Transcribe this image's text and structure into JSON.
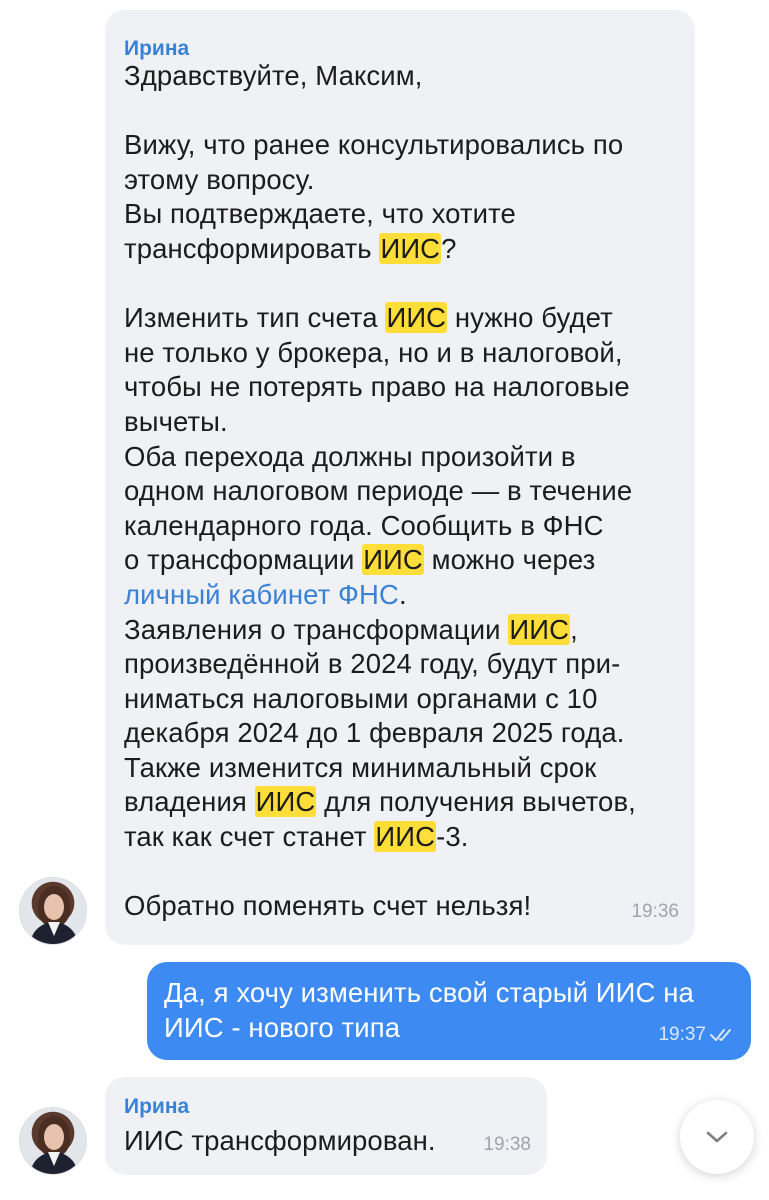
{
  "chat": {
    "messages": [
      {
        "sender": "Ирина",
        "time": "19:36",
        "lines": [
          [
            {
              "t": "Здравствуйте, Максим,"
            }
          ],
          [],
          [
            {
              "t": "Вижу, что ранее консультировались по"
            }
          ],
          [
            {
              "t": "этому вопросу."
            }
          ],
          [
            {
              "t": "Вы подтверждаете, что хотите"
            }
          ],
          [
            {
              "t": "трансформировать "
            },
            {
              "t": "ИИС",
              "hl": true
            },
            {
              "t": "?"
            }
          ],
          [],
          [
            {
              "t": "Изменить тип счета "
            },
            {
              "t": "ИИС",
              "hl": true
            },
            {
              "t": " нужно будет"
            }
          ],
          [
            {
              "t": "не только у брокера, но и в налоговой,"
            }
          ],
          [
            {
              "t": "чтобы не потерять право на налоговые"
            }
          ],
          [
            {
              "t": "вычеты."
            }
          ],
          [
            {
              "t": "Оба перехода должны произойти в"
            }
          ],
          [
            {
              "t": "одном налоговом периоде — в течение"
            }
          ],
          [
            {
              "t": "календарного года. Сообщить в ФНС"
            }
          ],
          [
            {
              "t": "о трансформации "
            },
            {
              "t": "ИИС",
              "hl": true
            },
            {
              "t": " можно через"
            }
          ],
          [
            {
              "t": "личный кабинет ФНС",
              "link": true
            },
            {
              "t": "."
            }
          ],
          [
            {
              "t": "Заявления о трансформации "
            },
            {
              "t": "ИИС",
              "hl": true
            },
            {
              "t": ","
            }
          ],
          [
            {
              "t": "произведённой в 2024 году, будут при-"
            }
          ],
          [
            {
              "t": "ниматься налоговыми органами с 10"
            }
          ],
          [
            {
              "t": "декабря 2024 до 1 февраля 2025 года."
            }
          ],
          [
            {
              "t": "Также изменится минимальный срок"
            }
          ],
          [
            {
              "t": "владения "
            },
            {
              "t": "ИИС",
              "hl": true
            },
            {
              "t": " для получения вычетов,"
            }
          ],
          [
            {
              "t": "так как счет станет "
            },
            {
              "t": "ИИС",
              "hl": true
            },
            {
              "t": "-3."
            }
          ],
          [],
          [
            {
              "t": "Обратно поменять счет нельзя!"
            }
          ]
        ]
      },
      {
        "outgoing": true,
        "time": "19:37",
        "lines": [
          "Да, я хочу изменить свой старый ИИС на",
          "ИИС - нового типа"
        ]
      },
      {
        "sender": "Ирина",
        "time": "19:38",
        "text": "ИИС трансформирован."
      }
    ]
  },
  "colors": {
    "incoming_bubble": "#eff1f4",
    "outgoing_bubble": "#3d8af2",
    "highlight": "#ffde3a",
    "accent": "#3a82d6"
  },
  "icons": {
    "read_receipt": "double-check-icon",
    "scroll_down": "chevron-down-icon"
  }
}
